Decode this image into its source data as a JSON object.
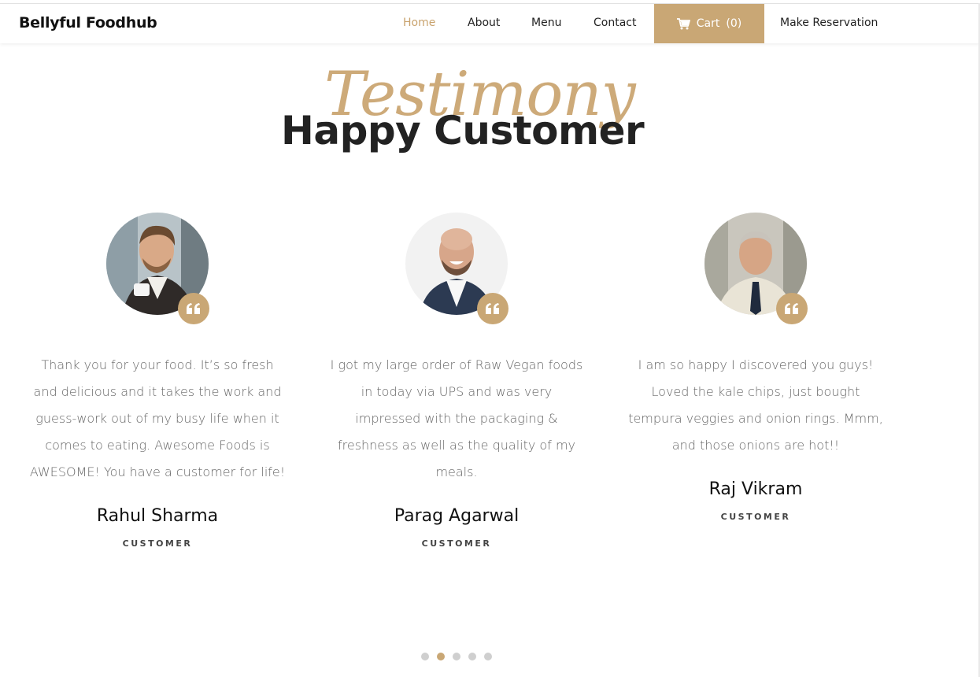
{
  "brand": "Bellyful Foodhub",
  "nav": {
    "home": "Home",
    "about": "About",
    "menu": "Menu",
    "contact": "Contact",
    "cart_label": "Cart",
    "cart_count": "(0)",
    "reservation": "Make Reservation"
  },
  "section": {
    "script_title": "Testimony",
    "title": "Happy Customer"
  },
  "testimonials": [
    {
      "text": "Thank you for your food. It’s so fresh and delicious and it takes the work and guess-work out of my busy life when it comes to eating. Awesome Foods is AWESOME! You have a customer for life!",
      "name": "Rahul Sharma",
      "role": "CUSTOMER"
    },
    {
      "text": "I got my large order of Raw Vegan foods in today via UPS and was very impressed with the packaging & freshness as well as the quality of my meals.",
      "name": "Parag Agarwal",
      "role": "CUSTOMER"
    },
    {
      "text": "I am so happy I discovered you guys! Loved the kale chips, just bought tempura veggies and onion rings. Mmm, and those onions are hot!!",
      "name": "Raj Vikram",
      "role": "CUSTOMER"
    }
  ],
  "carousel": {
    "total_slides": 5,
    "active_slide": 2
  },
  "colors": {
    "accent": "#c9a775",
    "heading": "#222222",
    "body_text": "#666666"
  },
  "icons": [
    "cart-icon",
    "quote-icon"
  ]
}
